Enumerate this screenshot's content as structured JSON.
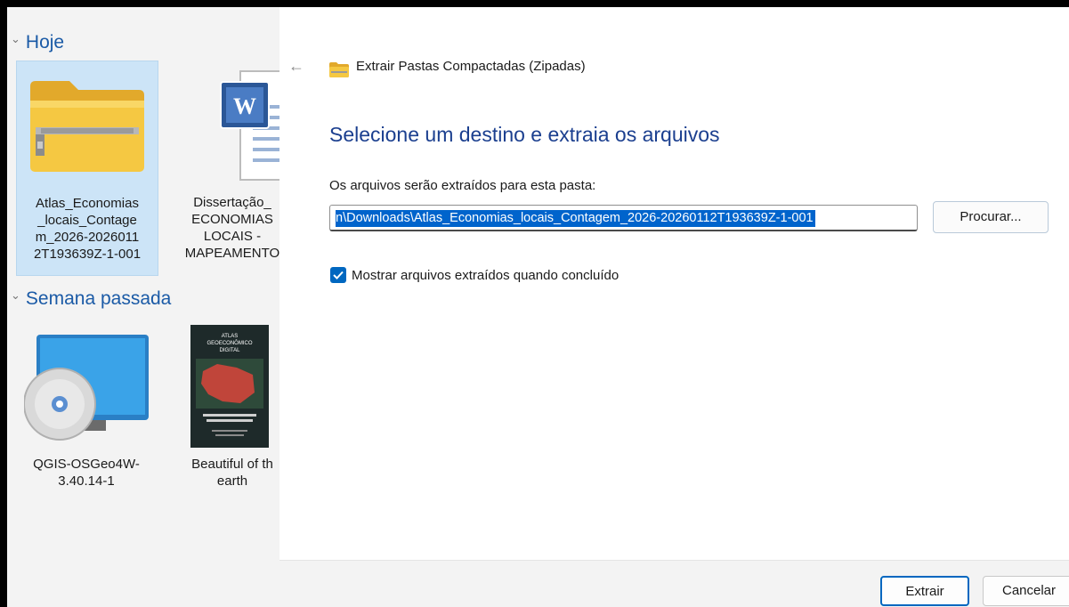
{
  "explorer": {
    "groups": [
      {
        "label": "Hoje"
      },
      {
        "label": "Semana passada"
      }
    ],
    "items": [
      {
        "label": "Atlas_Economias\n_locais_Contage\nm_2026-2026011\n2T193639Z-1-001",
        "icon": "zip-folder-icon"
      },
      {
        "label": "Dissertação_\nECONOMIAS\nLOCAIS -\nMAPEAMENTO",
        "icon": "word-document-icon"
      },
      {
        "label": "QGIS-OSGeo4W-\n3.40.14-1",
        "icon": "installer-disc-icon"
      },
      {
        "label": "Beautiful of th\nearth",
        "icon": "atlas-cover-thumbnail"
      }
    ],
    "thumbnail_text": {
      "line1": "ATLAS",
      "line2": "GEOECONÔMICO",
      "line3": "DIGITAL"
    }
  },
  "dialog": {
    "title": "Extrair Pastas Compactadas (Zipadas)",
    "instruction": "Selecione um destino e extraia os arquivos",
    "destination_label": "Os arquivos serão extraídos para esta pasta:",
    "destination_value": "n\\Downloads\\Atlas_Economias_locais_Contagem_2026-20260112T193639Z-1-001",
    "browse_label": "Procurar...",
    "show_files_label": "Mostrar arquivos extraídos quando concluído",
    "show_files_checked": true,
    "extract_label": "Extrair",
    "cancel_label": "Cancelar"
  },
  "colors": {
    "accent": "#0067c0",
    "heading": "#1b3f8f",
    "selection": "#0064cc"
  }
}
